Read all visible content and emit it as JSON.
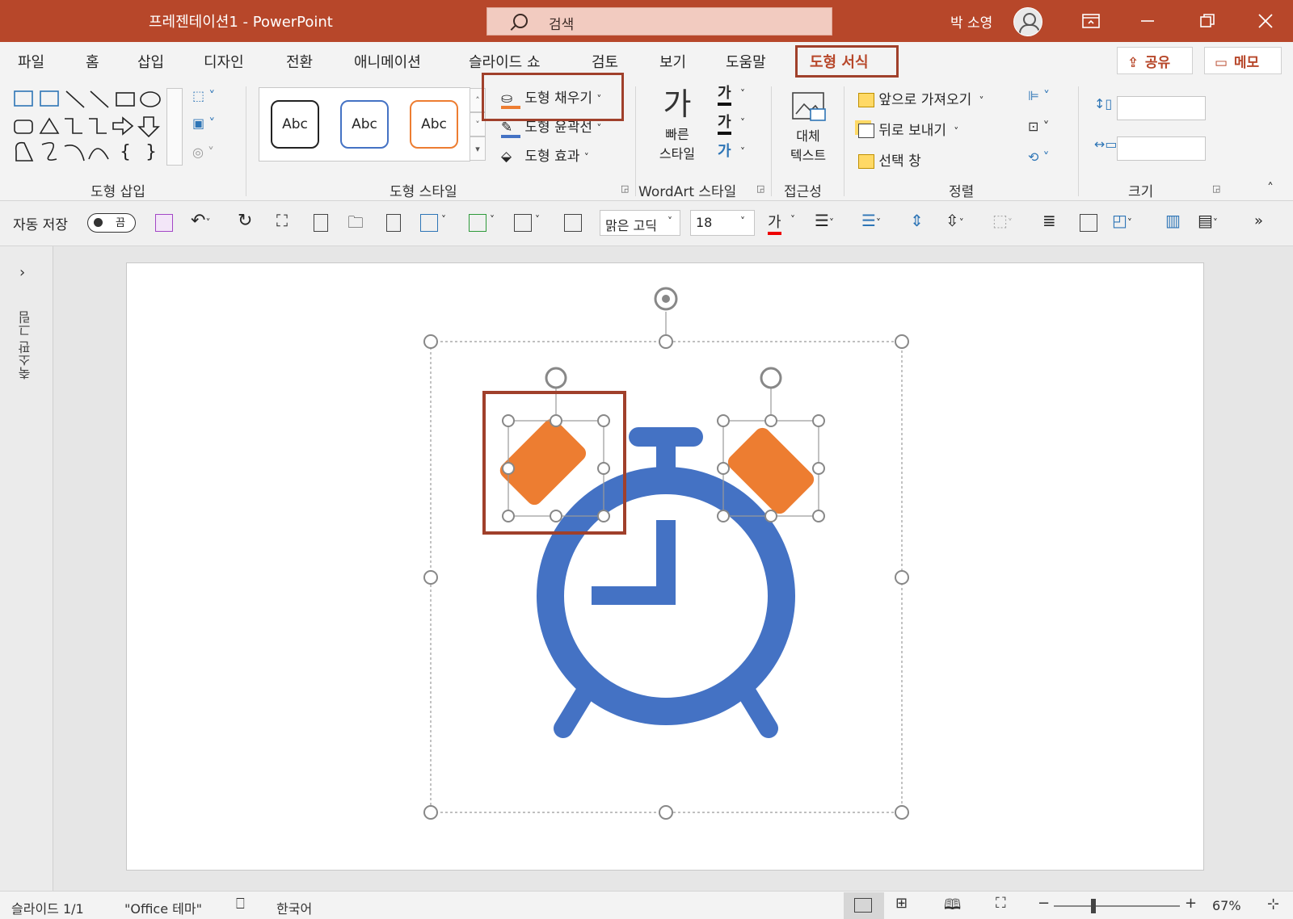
{
  "titlebar": {
    "title": "프레젠테이션1  -  PowerPoint",
    "search_placeholder": "검색",
    "user_name": "박 소영",
    "window_controls": [
      "ribbon-display-icon",
      "minimize-icon",
      "restore-icon",
      "close-icon"
    ]
  },
  "menubar": {
    "tabs": [
      "파일",
      "홈",
      "삽입",
      "디자인",
      "전환",
      "애니메이션",
      "슬라이드 쇼",
      "검토",
      "보기",
      "도움말",
      "도형 서식"
    ],
    "active_tab": "도형 서식",
    "share_label": "공유",
    "comment_label": "메모"
  },
  "ribbon": {
    "groups": {
      "insert_shapes": "도형 삽입",
      "shape_styles": "도형 스타일",
      "wordart_styles": "WordArt 스타일",
      "accessibility": "접근성",
      "arrange": "정렬",
      "size": "크기"
    },
    "style_gallery": [
      "Abc",
      "Abc",
      "Abc"
    ],
    "shape_fill": "도형 채우기",
    "shape_outline": "도형 윤곽선",
    "shape_effects": "도형 효과",
    "quick_styles_line1": "빠른",
    "quick_styles_line2": "스타일",
    "wordart_glyph": "가",
    "alt_text_line1": "대체",
    "alt_text_line2": "텍스트",
    "bring_forward": "앞으로 가져오기",
    "send_backward": "뒤로 보내기",
    "selection_pane": "선택 창",
    "height_value": "",
    "width_value": ""
  },
  "qat": {
    "autosave_label": "자동 저장",
    "autosave_state": "끔",
    "font_name": "맑은 고딕",
    "font_size": "18",
    "font_color_glyph": "가",
    "overflow": "»"
  },
  "left_pane": {
    "label": "축소판 그림",
    "expand_glyph": "›"
  },
  "slide": {
    "clock_color": "#4472c4",
    "bell_color": "#ed7d31"
  },
  "statusbar": {
    "slide_info": "슬라이드 1/1",
    "theme": "\"Office 테마\"",
    "language": "한국어",
    "zoom": "67%",
    "zoom_minus": "−",
    "zoom_plus": "+",
    "zoom_level": 0.67
  },
  "colors": {
    "accent": "#b7472a",
    "highlight_box": "#a0402b"
  }
}
